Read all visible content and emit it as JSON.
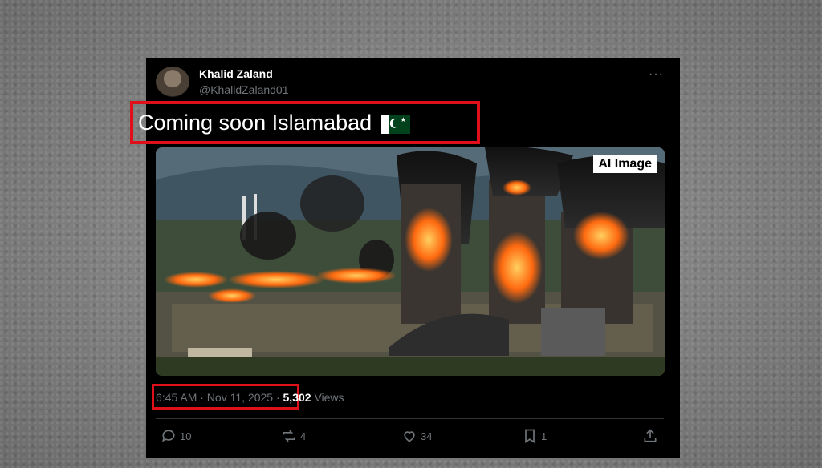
{
  "tweet": {
    "author_name": "Khalid Zaland",
    "author_handle": "@KhalidZaland01",
    "more_label": "···",
    "text": "Coming soon Islamabad",
    "media_badge": "AI Image",
    "timestamp": "6:45 AM · Nov 11, 2025",
    "separator": "·",
    "views_count": "5,302",
    "views_label": "Views",
    "actions": {
      "replies": "10",
      "reposts": "4",
      "likes": "34",
      "bookmarks": "1"
    }
  },
  "colors": {
    "highlight_border": "#e0101a",
    "background_tweet": "#000000",
    "muted_text": "#71767b"
  },
  "icons": [
    "avatar",
    "more-icon",
    "pakistan-flag-icon",
    "reply-icon",
    "repost-icon",
    "like-icon",
    "bookmark-icon",
    "share-icon"
  ]
}
